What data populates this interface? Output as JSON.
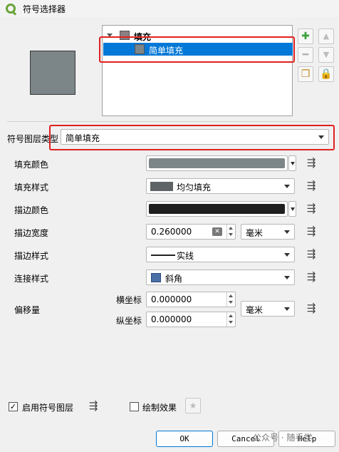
{
  "window": {
    "title": "符号选择器"
  },
  "tree": {
    "parent_label": "填充",
    "child_label": "简单填充"
  },
  "layer_type": {
    "label": "符号图层类型",
    "value": "简单填充"
  },
  "fields": {
    "fill_color": {
      "label": "填充颜色",
      "color": "#7c8588"
    },
    "fill_style": {
      "label": "填充样式",
      "value": "均匀填充"
    },
    "stroke_color": {
      "label": "描边颜色",
      "color": "#1e1e1e"
    },
    "stroke_width": {
      "label": "描边宽度",
      "value": "0.260000",
      "unit": "毫米"
    },
    "stroke_style": {
      "label": "描边样式",
      "value": "实线"
    },
    "join_style": {
      "label": "连接样式",
      "value": "斜角"
    },
    "offset": {
      "label": "偏移量",
      "x_label": "横坐标",
      "x_value": "0.000000",
      "y_label": "纵坐标",
      "y_value": "0.000000",
      "unit": "毫米"
    }
  },
  "bottom": {
    "enable_layer": "启用符号图层",
    "draw_effects": "绘制效果",
    "ok": "OK",
    "cancel": "Cancel",
    "help": "Help"
  },
  "watermark": "公众号 · 随手学"
}
